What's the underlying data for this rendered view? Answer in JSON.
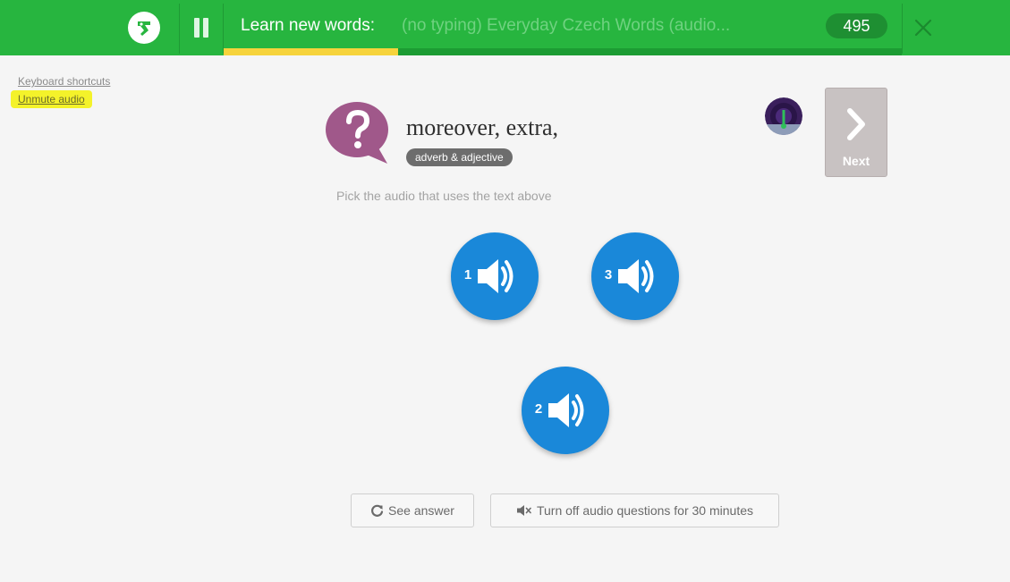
{
  "header": {
    "session_label": "Learn new words:",
    "course_name": "(no typing) Everyday Czech Words (audio...",
    "score": "495",
    "progress_fraction": 0.257,
    "icons": {
      "logo": "memrise-logo-icon",
      "pause": "pause-icon",
      "close": "close-icon"
    }
  },
  "sidebar_links": {
    "keyboard_shortcuts": "Keyboard shortcuts",
    "unmute_audio": "Unmute audio"
  },
  "prompt": {
    "text": "moreover, extra,",
    "part_of_speech": "adverb & adjective",
    "instruction": "Pick the audio that uses the text above",
    "question_icon": "question-bubble-icon"
  },
  "next_button": {
    "label": "Next"
  },
  "choices": [
    {
      "number": "1"
    },
    {
      "number": "3"
    },
    {
      "number": "2"
    }
  ],
  "actions": {
    "see_answer": "See answer",
    "turn_off_audio": "Turn off audio questions for 30 minutes"
  },
  "colors": {
    "header_green": "#27b53f",
    "progress_yellow": "#f6d33c",
    "audio_blue": "#1a88d9",
    "question_purple": "#a0588a",
    "highlight_yellow": "#f4f22a"
  }
}
